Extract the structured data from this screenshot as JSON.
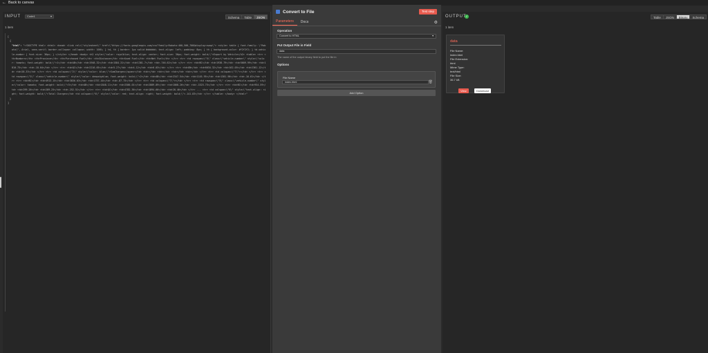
{
  "topbar": {
    "back_label": "Back to canvas"
  },
  "input": {
    "title": "INPUT",
    "node_select": "Code1",
    "tabs": [
      "Schema",
      "Table",
      "JSON"
    ],
    "active_tab": "JSON",
    "items_count": "1 item",
    "json_open": "[",
    "json_open2": "{",
    "key": "\"html\":",
    "value": "\"<!DOCTYPE html> <html> <head> <link rel=\\\"stylesheet\\\" href=\\\"https://fonts.googleapis.com/css?family=Roboto:400,500,700&display=swap\\\"> <style> table { font-family: \\\"Roboto\\\", Arial, sans-serif; border-collapse: collapse; width: 100%; } td, th { border: 1px solid #dddddd; text-align: left; padding: 8px; } th { background-color: #f2f2f2; } td.vehicle-number { font-size: 36px; } </style> </head> <body> <h2 style=\\\"color: royalblue; text-align: center; font-size: 36px; font-weight: bold;\\\">Export by Vehicle</h2> <table> <tr> <th>Numbers</th> <th>Province</th> <th>Purchased Fuel</th> <th>Distance</th> <th>Used Fuel</th> <th>Net Fuel</th> </tr> <tr> <td rowspan=\\\"5\\\" class=\\\"vehicle-number\\\" style=\\\"color: tomato; font-weight: bold;\\\">1</td> <td>AB</td> <td>1948.32</td> <td>1584.31</td> <td>1381.7</td> <td>-746.62</td> </tr> <tr> <td>BC</td> <td>1938.79</td> <td>5609.99</td> <td>1810.75</td> <td>-18.04</td> </tr> <tr> <td>QC</td> <td>2216.65</td> <td>5.27</td> <td>4.12</td> <td>6.03</td> </tr> <tr> <td>ON</td> <td>6034.32</td> <td>162.05</td> <td>2361.12</td> <td>28.33</td> </tr> <tr> <td colspan=\\\"2\\\" style=\\\"color: blue;\\\">SumCharges</span></td> <td></td> <td></td> <td></td> <td></td> </tr> <tr> <td colspan=\\\"7\\\"></td> </tr> <tr> <td rowspan=\\\"5\\\" class=\\\"vehicle-number\\\" style=\\\"color: deepskyblue; font-weight: bold;\\\">2</td> <td>AB</td> <td>2347.54</td> <td>1145.95</td> <td>1381.98</td> <td>-16.61</td> </tr> <tr> <td>BC</td> <td>4913.15</td> <td>3836.03</td> <td>1757.44</td> <td>-87.75</td> </tr> <tr> <td colspan=\\\"7\\\"></td> </tr> <tr> <td rowspan=\\\"5\\\" class=\\\"vehicle-number\\\" style=\\\"color: tomato; font-weight: bold;\\\">3</td> <td>AB</td> <td>1848.11</td> <td>2586.01</td> <td>2889.89</td> <td>1868.26</td> <td>-1525.75</td> </tr> <tr> <td>BC</td> <td>954.59</td> <td>299.26</td> <td>289.25</td> <td>-252.51</td> </tr> <tr> <td>QC</td> <td>4782.36</td> <td>1894.66</td> <td>28.46</td> </tr> ... <tr> <td colspan=\\\"6\\\" style=\\\"text-align: right; font-weight: bold;\\\">Total Charges</td> <td colspan=\\\"6\\\" style=\\\"color: red; text-align: right; font-weight: bold;\\\">-141.83</td> </tr> </table> </body> </html>\"",
    "json_close2": "}",
    "json_close": "]"
  },
  "node": {
    "title": "Convert to File",
    "test_label": "Test step",
    "tabs": [
      "Parameters",
      "Docs"
    ],
    "operation_label": "Operation",
    "operation_value": "Convert to HTML",
    "output_field_label": "Put Output File in Field",
    "output_field_value": "data",
    "output_field_hint": "The name of the output binary field to put the file in",
    "options_label": "Options",
    "file_name_label": "File Name",
    "file_name_value": "index.html",
    "add_option_label": "Add Option"
  },
  "output": {
    "title": "OUTPUT",
    "items_count": "1 item",
    "tabs": [
      "Table",
      "JSON",
      "Binary",
      "Schema"
    ],
    "active_tab": "Binary",
    "binary": {
      "name": "data",
      "file_name_label": "File Name:",
      "file_name": "index.html",
      "file_ext_label": "File Extension:",
      "file_ext": "html",
      "mime_label": "Mime Type:",
      "mime": "text/html",
      "size_label": "File Size:",
      "size": "36.7 kB",
      "view_label": "View",
      "download_label": "Download"
    }
  }
}
